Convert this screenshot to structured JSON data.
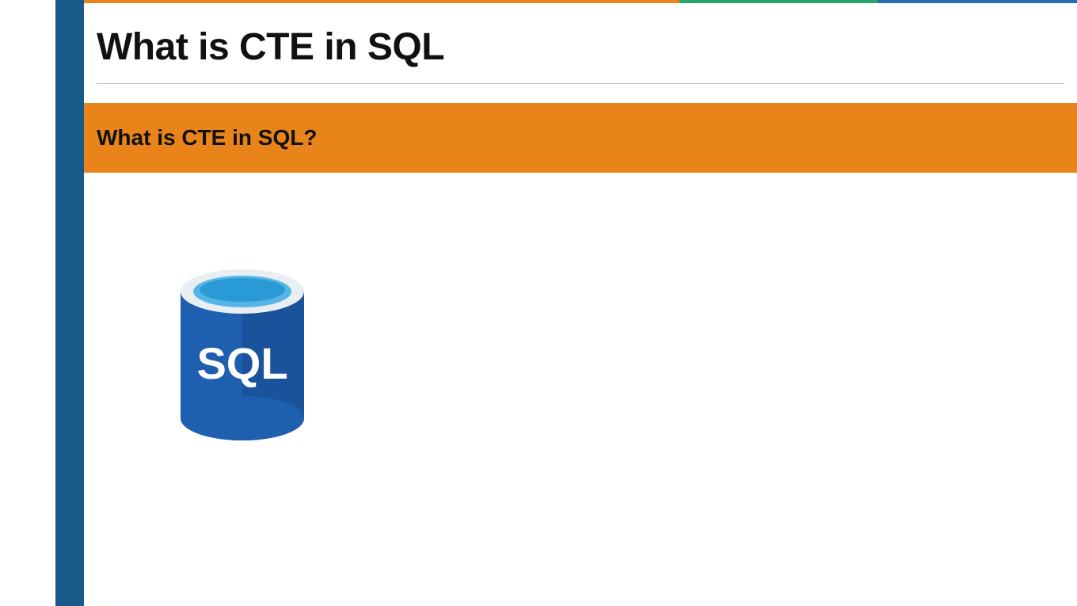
{
  "title": "What is CTE in SQL",
  "question": "What is CTE in SQL?",
  "icon_label": "SQL",
  "colors": {
    "sidebar": "#1a5a8a",
    "band": "#e8841a",
    "accent_green": "#27a56a",
    "accent_blue": "#2a6cb3",
    "db_body": "#1e5fb0",
    "db_top": "#55b5e6",
    "db_rim": "#e8eef2"
  }
}
